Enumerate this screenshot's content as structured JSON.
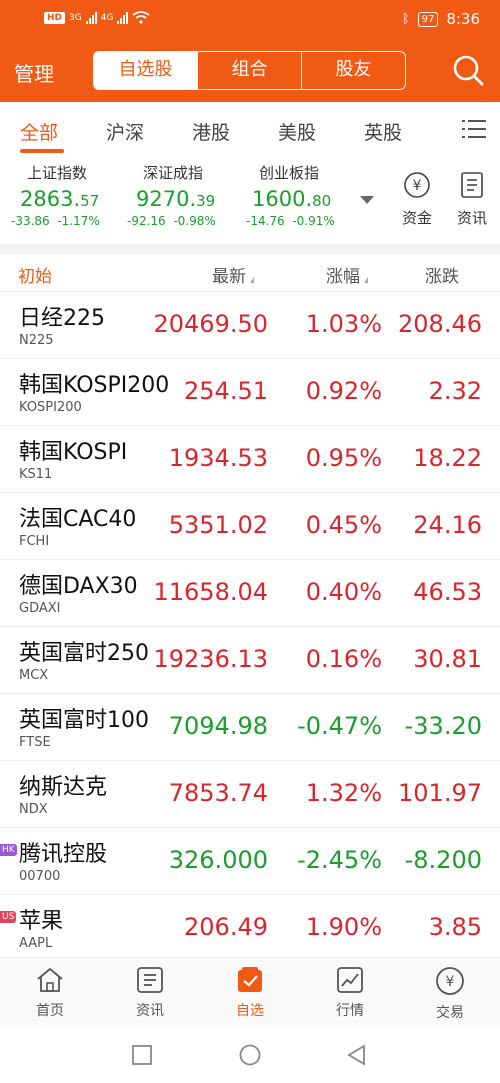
{
  "status_bar": {
    "left_chip": "HD",
    "net1": "3G",
    "net2": "4G",
    "battery": "97",
    "time": "8:36"
  },
  "header": {
    "left_label": "管理",
    "segments": [
      "自选股",
      "组合",
      "股友"
    ],
    "active_segment": 0
  },
  "categories": {
    "items": [
      "全部",
      "沪深",
      "港股",
      "美股",
      "英股"
    ],
    "active": 0
  },
  "indices": [
    {
      "name": "上证指数",
      "value_main": "2863.",
      "value_frac": "57",
      "change": "-33.86",
      "pct": "-1.17%"
    },
    {
      "name": "深证成指",
      "value_main": "9270.",
      "value_frac": "39",
      "change": "-92.16",
      "pct": "-0.98%"
    },
    {
      "name": "创业板指",
      "value_main": "1600.",
      "value_frac": "80",
      "change": "-14.76",
      "pct": "-0.91%"
    }
  ],
  "quick_links": {
    "funds": "资金",
    "news": "资讯"
  },
  "columns": {
    "initial": "初始",
    "latest": "最新",
    "pct": "涨幅",
    "change": "涨跌"
  },
  "rows": [
    {
      "name": "日经225",
      "code": "N225",
      "price": "20469.50",
      "pct": "1.03%",
      "change": "208.46",
      "dir": "up",
      "badge": ""
    },
    {
      "name": "韩国KOSPI200",
      "code": "KOSPI200",
      "price": "254.51",
      "pct": "0.92%",
      "change": "2.32",
      "dir": "up",
      "badge": ""
    },
    {
      "name": "韩国KOSPI",
      "code": "KS11",
      "price": "1934.53",
      "pct": "0.95%",
      "change": "18.22",
      "dir": "up",
      "badge": ""
    },
    {
      "name": "法国CAC40",
      "code": "FCHI",
      "price": "5351.02",
      "pct": "0.45%",
      "change": "24.16",
      "dir": "up",
      "badge": ""
    },
    {
      "name": "德国DAX30",
      "code": "GDAXI",
      "price": "11658.04",
      "pct": "0.40%",
      "change": "46.53",
      "dir": "up",
      "badge": ""
    },
    {
      "name": "英国富时250",
      "code": "MCX",
      "price": "19236.13",
      "pct": "0.16%",
      "change": "30.81",
      "dir": "up",
      "badge": ""
    },
    {
      "name": "英国富时100",
      "code": "FTSE",
      "price": "7094.98",
      "pct": "-0.47%",
      "change": "-33.20",
      "dir": "down",
      "badge": ""
    },
    {
      "name": "纳斯达克",
      "code": "NDX",
      "price": "7853.74",
      "pct": "1.32%",
      "change": "101.97",
      "dir": "up",
      "badge": ""
    },
    {
      "name": "腾讯控股",
      "code": "00700",
      "price": "326.000",
      "pct": "-2.45%",
      "change": "-8.200",
      "dir": "down",
      "badge": "HK"
    },
    {
      "name": "苹果",
      "code": "AAPL",
      "price": "206.49",
      "pct": "1.90%",
      "change": "3.85",
      "dir": "up",
      "badge": "US"
    }
  ],
  "bottom_nav": {
    "items": [
      "首页",
      "资讯",
      "自选",
      "行情",
      "交易"
    ],
    "active": 2
  },
  "colors": {
    "accent": "#f05a14",
    "up": "#d8262c",
    "down": "#1a9e2c",
    "badge_hk": "#9b59d0",
    "badge_us": "#e0455a"
  },
  "icons": [
    "search-icon",
    "menu-icon",
    "yen-circle-icon",
    "news-icon",
    "home-icon",
    "news-list-icon",
    "watchlist-icon",
    "chart-icon",
    "trade-icon"
  ]
}
